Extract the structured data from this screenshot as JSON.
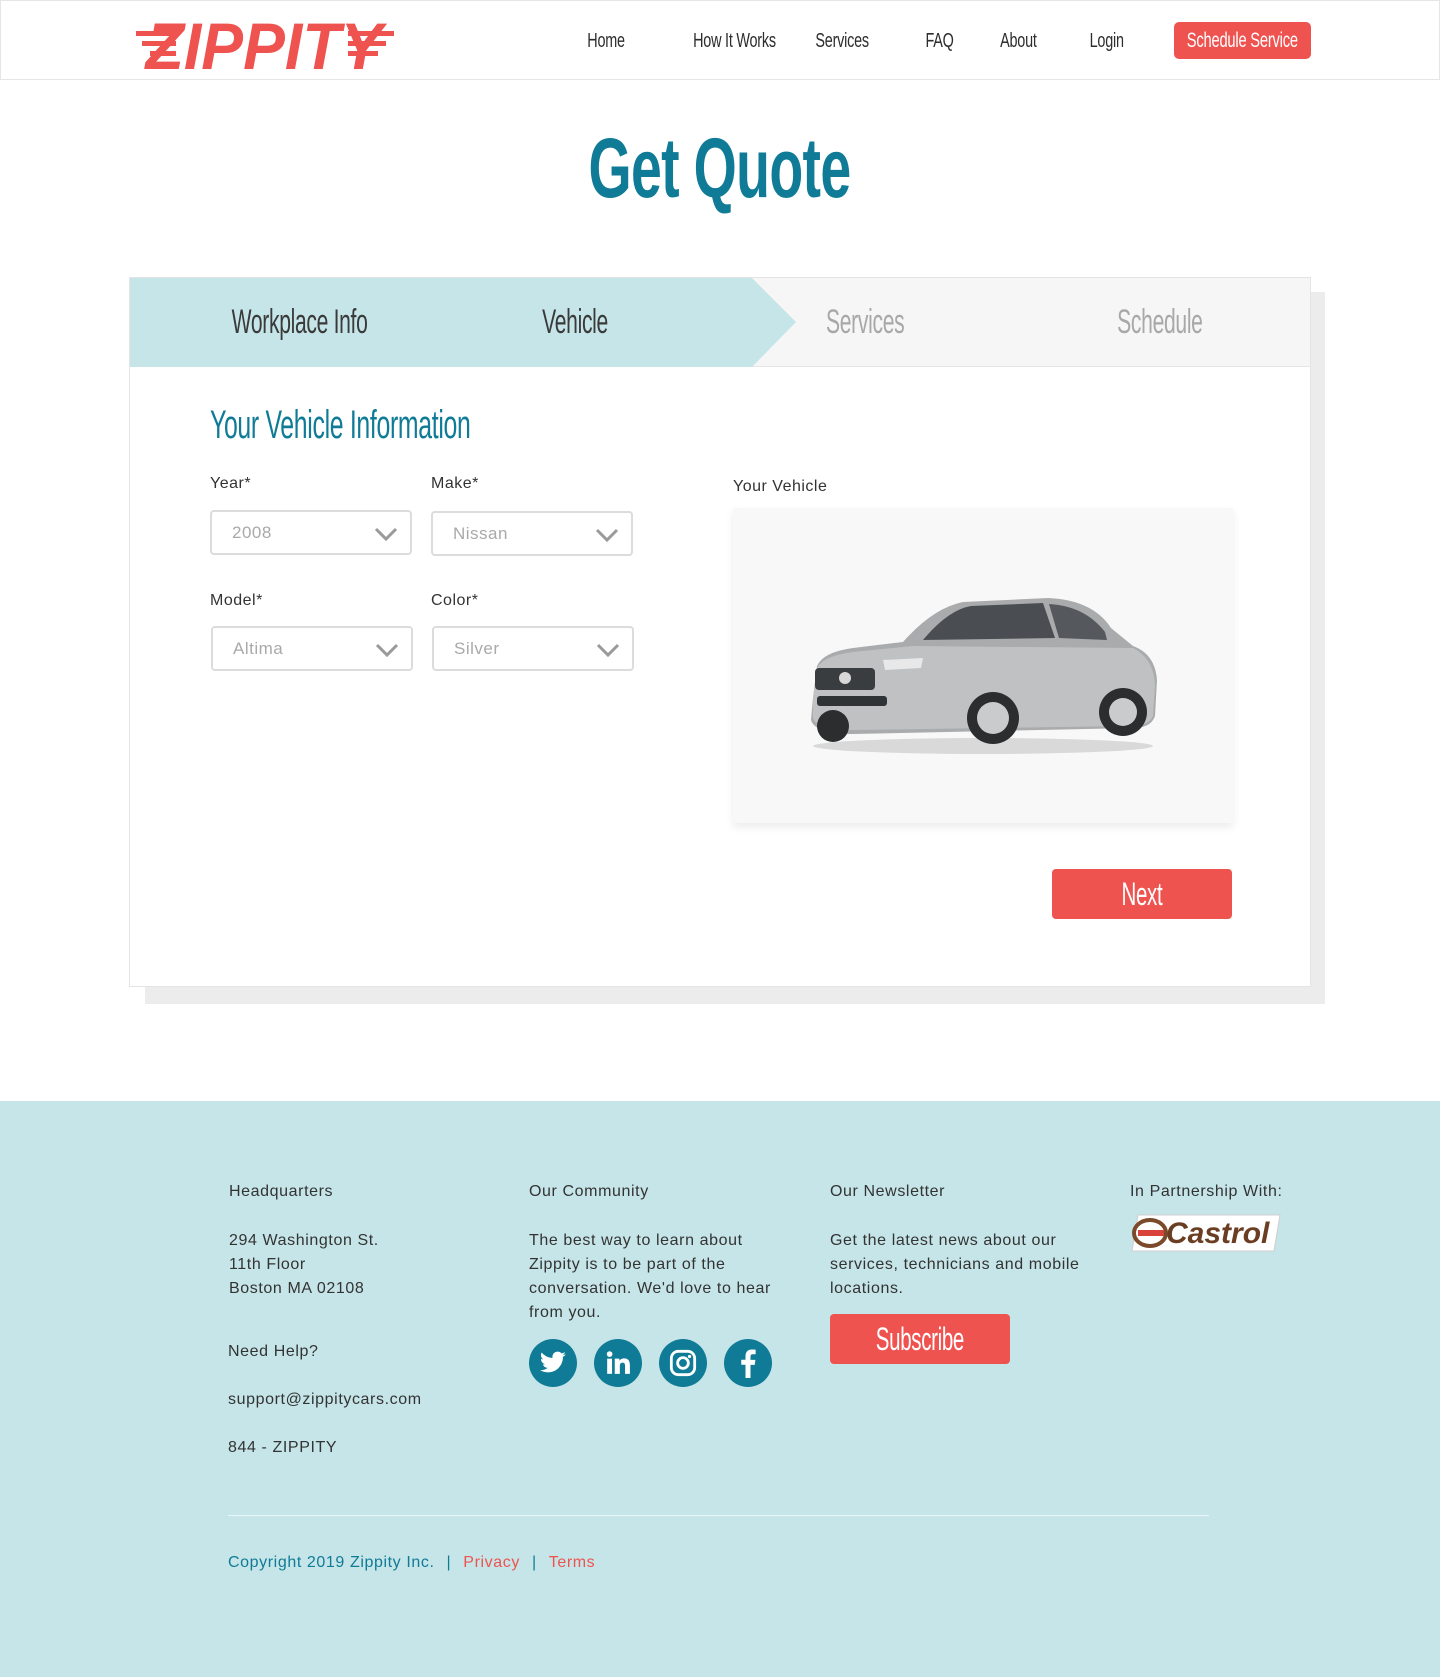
{
  "brand": {
    "logo_text": "ZIPPITY",
    "accent": "#ef5350",
    "primary": "#0f7b96",
    "footer_bg": "#c6e5e8",
    "step_active_bg": "#c6e5e8"
  },
  "nav": {
    "items": [
      "Home",
      "How It Works",
      "Services",
      "FAQ",
      "About",
      "Login"
    ],
    "cta": "Schedule Service"
  },
  "page": {
    "title": "Get Quote"
  },
  "steps": [
    {
      "label": "Workplace Info",
      "state": "done"
    },
    {
      "label": "Vehicle",
      "state": "current"
    },
    {
      "label": "Services",
      "state": "todo"
    },
    {
      "label": "Schedule",
      "state": "todo"
    }
  ],
  "form": {
    "section_title": "Your Vehicle Information",
    "year": {
      "label": "Year*",
      "value": "2008"
    },
    "make": {
      "label": "Make*",
      "value": "Nissan"
    },
    "model": {
      "label": "Model*",
      "value": "Altima"
    },
    "color": {
      "label": "Color*",
      "value": "Silver"
    },
    "vehicle_label": "Your Vehicle",
    "next": "Next"
  },
  "footer": {
    "hq": {
      "heading": "Headquarters",
      "line1": "294 Washington St.",
      "line2": "11th Floor",
      "line3": "Boston MA 02108"
    },
    "help": {
      "heading": "Need Help?",
      "email": "support@zippitycars.com",
      "phone": "844 - ZIPPITY"
    },
    "community": {
      "heading": "Our Community",
      "text": "The best way to learn about Zippity is to be part of the conversation. We'd love to hear from you.",
      "icons": [
        "twitter-icon",
        "linkedin-icon",
        "instagram-icon",
        "facebook-icon"
      ]
    },
    "newsletter": {
      "heading": "Our Newsletter",
      "text": "Get the latest news about our services, technicians and mobile locations.",
      "button": "Subscribe"
    },
    "partner": {
      "heading": "In Partnership With:",
      "logo_text": "Castrol"
    },
    "copyright": "Copyright 2019 Zippity Inc.",
    "sep": "|",
    "privacy": "Privacy",
    "terms": "Terms"
  }
}
